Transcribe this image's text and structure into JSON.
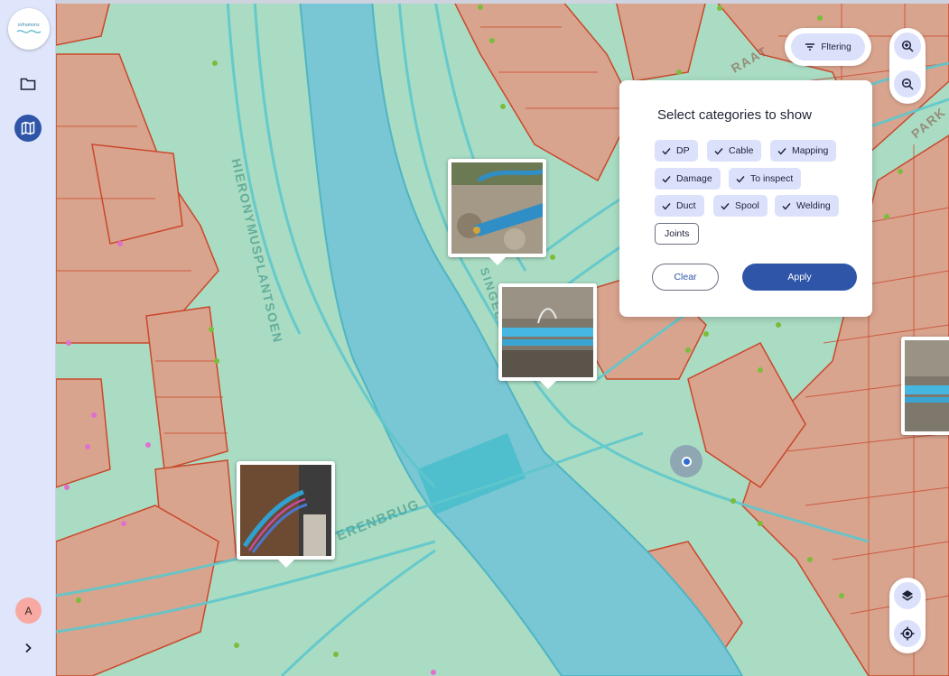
{
  "app": {
    "logo_text": "inframonx"
  },
  "sidebar": {
    "items": [
      {
        "name": "folder-icon"
      },
      {
        "name": "map-icon",
        "active": true
      }
    ],
    "avatar_initial": "A",
    "expand_icon": "chevron-right-icon"
  },
  "toolbar": {
    "filter_label": "Fltering",
    "filter_icon": "filter-icon",
    "zoom_in_icon": "zoom-in-icon",
    "zoom_out_icon": "zoom-out-icon",
    "layers_icon": "layers-icon",
    "locate_icon": "my-location-icon"
  },
  "filter_panel": {
    "title": "Select categories to show",
    "categories": [
      {
        "label": "DP",
        "selected": true
      },
      {
        "label": "Cable",
        "selected": true
      },
      {
        "label": "Mapping",
        "selected": true
      },
      {
        "label": "Damage",
        "selected": true
      },
      {
        "label": "To inspect",
        "selected": true
      },
      {
        "label": "Duct",
        "selected": true
      },
      {
        "label": "Spool",
        "selected": true
      },
      {
        "label": "Welding",
        "selected": true
      },
      {
        "label": "Joints",
        "selected": false
      }
    ],
    "clear_label": "Clear",
    "apply_label": "Apply"
  },
  "map": {
    "street_labels": [
      "HIERONYMUSPLANTSOEN",
      "SINGEL",
      "ERENBRUG",
      "RAAT",
      "PARK"
    ],
    "colors": {
      "water": "#79c6d4",
      "parcel": "#d9a48e",
      "green": "#a9dcc3",
      "road": "#5fc7cc",
      "parcel_line": "#c9482c",
      "accent": "#2f55a8"
    }
  }
}
